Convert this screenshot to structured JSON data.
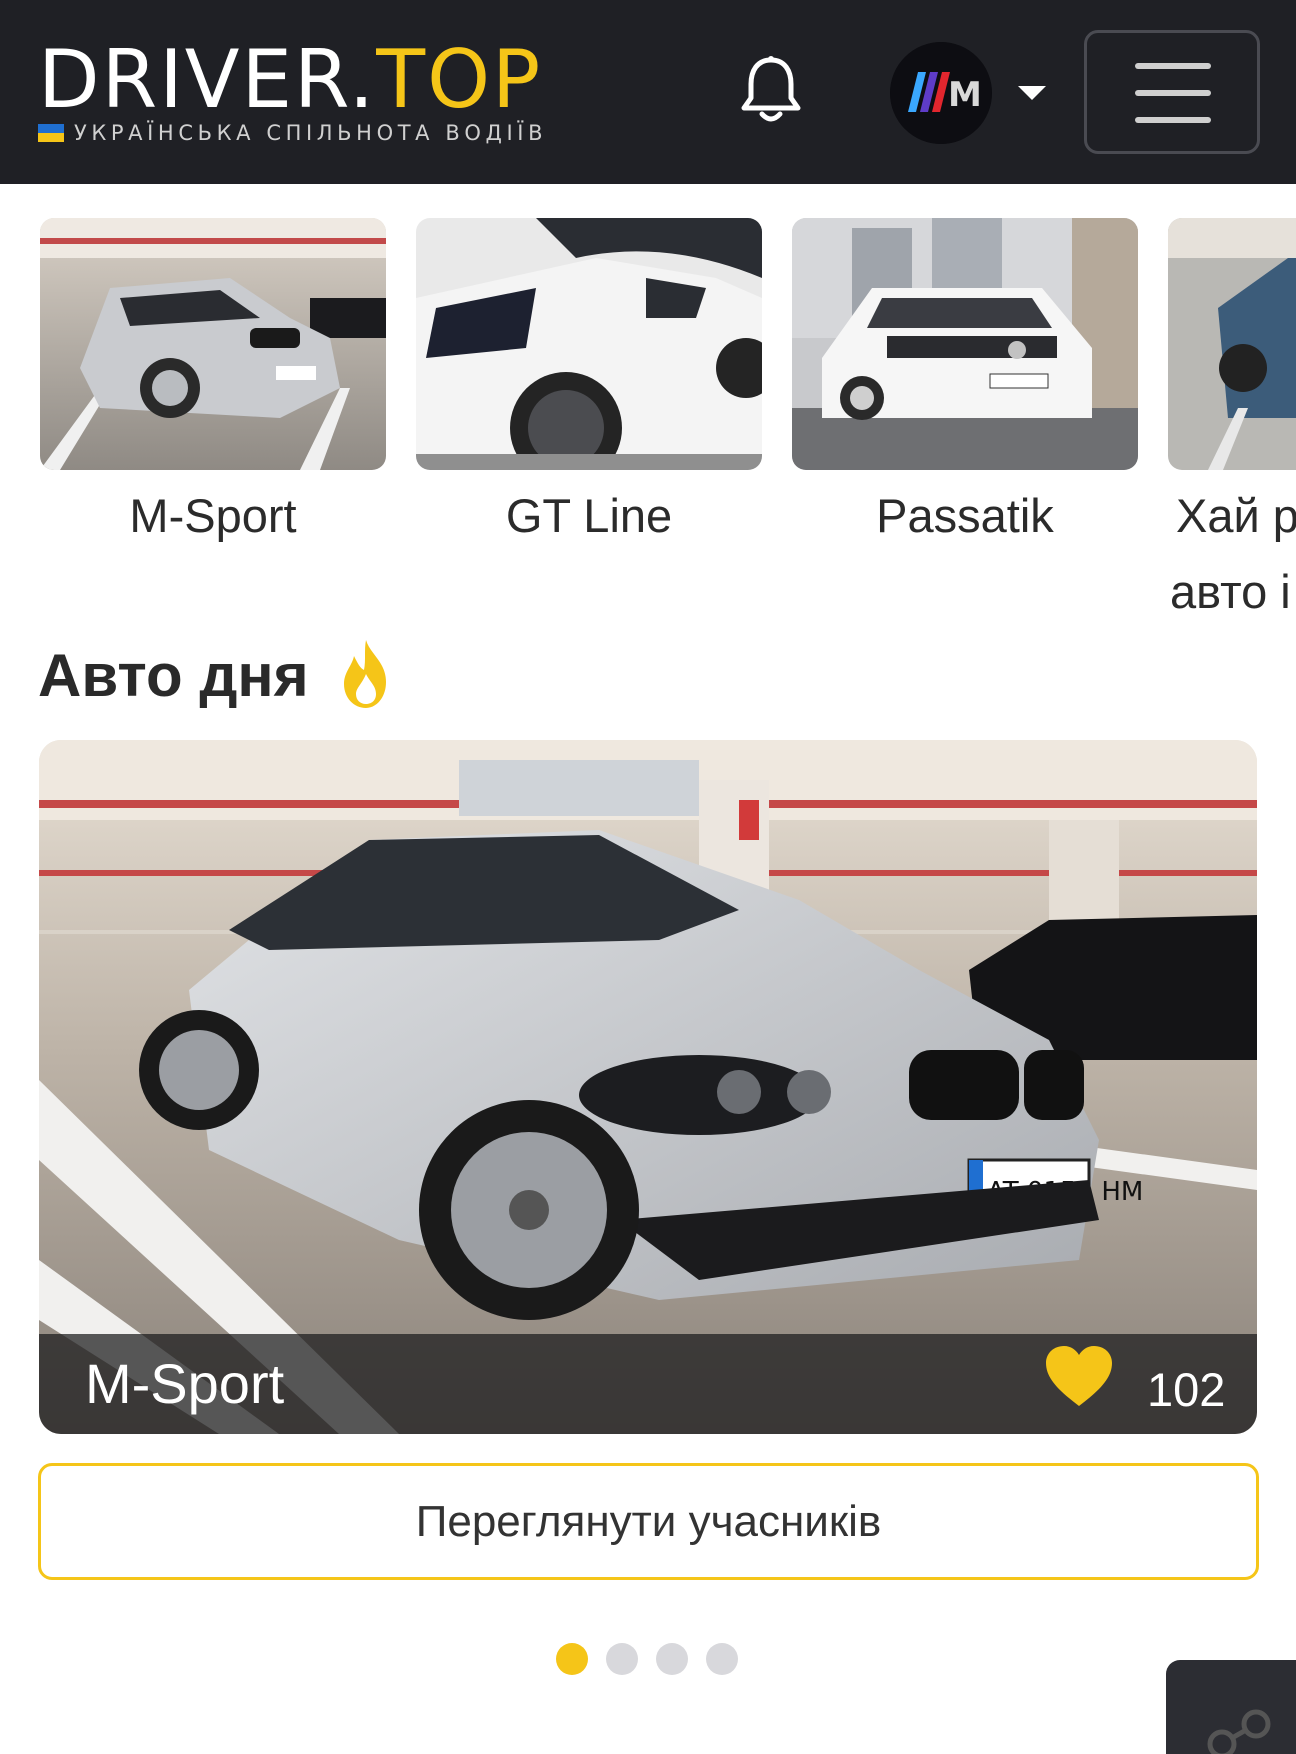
{
  "header": {
    "logo_main": "DRIVER.",
    "logo_accent": "TOP",
    "logo_subtitle": "УКРАЇНСЬКА СПІЛЬНОТА ВОДІЇВ",
    "icons": [
      "bell-icon",
      "avatar",
      "chevron-down-icon",
      "hamburger-menu-icon"
    ]
  },
  "thumbnails": [
    {
      "label": "M-Sport"
    },
    {
      "label": "GT Line"
    },
    {
      "label": "Passatik"
    },
    {
      "label": "Хай р",
      "label2": "авто і"
    }
  ],
  "section": {
    "title": "Авто дня",
    "icon": "fire-icon"
  },
  "feature": {
    "name": "M-Sport",
    "plate": "AT 0152 HM",
    "likes": "102",
    "icon": "heart-icon"
  },
  "view_button": "Переглянути учасників",
  "carousel": {
    "pages": 4,
    "active": 1
  },
  "colors": {
    "header_bg": "#1f2025",
    "accent": "#f5c518",
    "flag_blue": "#1f6fd1"
  }
}
